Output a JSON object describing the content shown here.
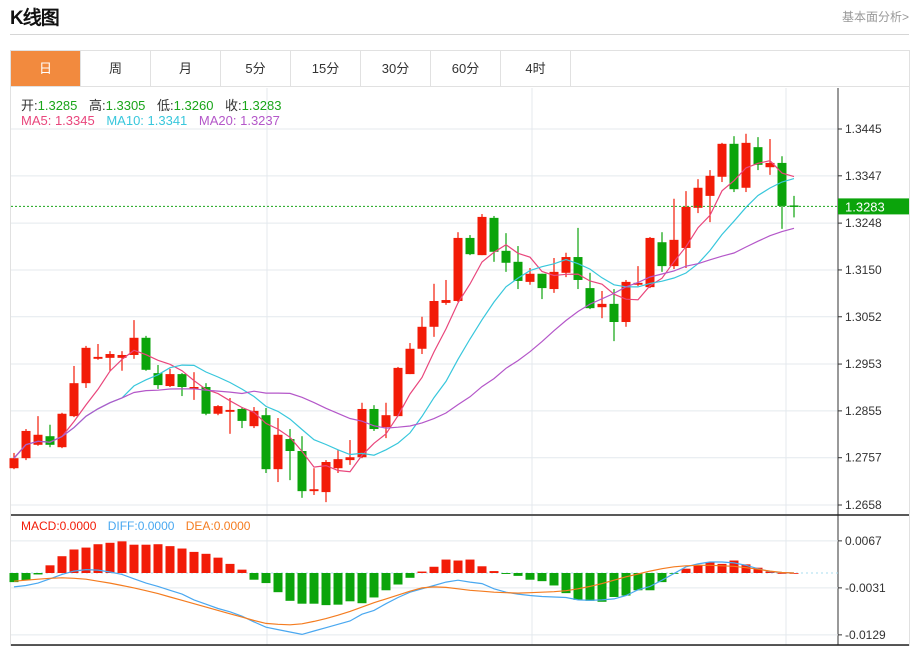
{
  "header": {
    "title": "K线图",
    "link": "基本面分析>"
  },
  "tabs": [
    {
      "label": "日",
      "active": true
    },
    {
      "label": "周"
    },
    {
      "label": "月"
    },
    {
      "label": "5分"
    },
    {
      "label": "15分"
    },
    {
      "label": "30分"
    },
    {
      "label": "60分"
    },
    {
      "label": "4时"
    }
  ],
  "ohlc_info": {
    "open_label": "开:",
    "open": "1.3285",
    "high_label": "高:",
    "high": "1.3305",
    "low_label": "低:",
    "low": "1.3260",
    "close_label": "收:",
    "close": "1.3283"
  },
  "ma_info": {
    "ma5": "MA5: 1.3345",
    "ma10": "MA10: 1.3341",
    "ma20": "MA20: 1.3237"
  },
  "macd_info": {
    "macd": "MACD:0.0000",
    "diff": "DIFF:0.0000",
    "dea": "DEA:0.0000"
  },
  "colors": {
    "up": "#f21b07",
    "down": "#0ba40b",
    "ma5": "#e9467c",
    "ma10": "#38c7dc",
    "ma20": "#b457c9",
    "dea": "#f47c20",
    "diff": "#4aa8f0",
    "accent": "#f28a3e"
  },
  "chart_data": {
    "type": "candlestick",
    "price_axis": {
      "ticks": [
        "1.3445",
        "1.3347",
        "1.3248",
        "1.3150",
        "1.3052",
        "1.2953",
        "1.2855",
        "1.2757",
        "1.2658"
      ],
      "range": [
        1.2658,
        1.3445
      ]
    },
    "last_price": "1.3283",
    "candles": [
      [
        1.2735,
        1.2767,
        1.2733,
        1.2756
      ],
      [
        1.2756,
        1.2817,
        1.2752,
        1.2813
      ],
      [
        1.2784,
        1.2844,
        1.2782,
        1.2805
      ],
      [
        1.2802,
        1.2826,
        1.2779,
        1.2784
      ],
      [
        1.2779,
        1.2851,
        1.2777,
        1.2849
      ],
      [
        1.2844,
        1.2949,
        1.2842,
        1.2913
      ],
      [
        1.2913,
        1.2991,
        1.2903,
        1.2987
      ],
      [
        1.2964,
        1.2995,
        1.2962,
        1.2968
      ],
      [
        1.2966,
        1.298,
        1.2939,
        1.2974
      ],
      [
        1.2966,
        1.298,
        1.2939,
        1.2972
      ],
      [
        1.2972,
        1.3045,
        1.2964,
        1.3008
      ],
      [
        1.3008,
        1.3012,
        1.2939,
        1.2941
      ],
      [
        1.2934,
        1.2951,
        1.2901,
        1.2909
      ],
      [
        1.2907,
        1.2943,
        1.2905,
        1.2932
      ],
      [
        1.2932,
        1.2934,
        1.2886,
        1.2905
      ],
      [
        1.2901,
        1.2936,
        1.2878,
        1.2905
      ],
      [
        1.2905,
        1.2913,
        1.2846,
        1.2849
      ],
      [
        1.2849,
        1.2867,
        1.2846,
        1.2865
      ],
      [
        1.2853,
        1.2882,
        1.2807,
        1.2857
      ],
      [
        1.2859,
        1.2863,
        1.2819,
        1.2834
      ],
      [
        1.2823,
        1.2863,
        1.2819,
        1.2855
      ],
      [
        1.2846,
        1.2861,
        1.2725,
        1.2733
      ],
      [
        1.2733,
        1.284,
        1.2706,
        1.2805
      ],
      [
        1.2796,
        1.2817,
        1.271,
        1.2771
      ],
      [
        1.2771,
        1.2802,
        1.2673,
        1.2687
      ],
      [
        1.2687,
        1.2735,
        1.2679,
        1.2691
      ],
      [
        1.2685,
        1.2752,
        1.2664,
        1.2748
      ],
      [
        1.2735,
        1.2773,
        1.2725,
        1.2754
      ],
      [
        1.2752,
        1.2794,
        1.2742,
        1.2758
      ],
      [
        1.2758,
        1.2872,
        1.2756,
        1.2859
      ],
      [
        1.2859,
        1.2867,
        1.2813,
        1.2817
      ],
      [
        1.2821,
        1.2872,
        1.2798,
        1.2846
      ],
      [
        1.2844,
        1.2947,
        1.2844,
        1.2945
      ],
      [
        1.2932,
        1.2997,
        1.2932,
        1.2985
      ],
      [
        1.2985,
        1.3052,
        1.2974,
        1.3031
      ],
      [
        1.3031,
        1.3121,
        1.301,
        1.3085
      ],
      [
        1.3081,
        1.3129,
        1.3077,
        1.3087
      ],
      [
        1.3085,
        1.3229,
        1.3083,
        1.3217
      ],
      [
        1.3217,
        1.3223,
        1.3181,
        1.3183
      ],
      [
        1.3181,
        1.3267,
        1.3181,
        1.3261
      ],
      [
        1.3259,
        1.3263,
        1.3167,
        1.3188
      ],
      [
        1.319,
        1.3227,
        1.3146,
        1.3165
      ],
      [
        1.3167,
        1.32,
        1.311,
        1.3127
      ],
      [
        1.3125,
        1.3154,
        1.3119,
        1.3142
      ],
      [
        1.3142,
        1.3142,
        1.3089,
        1.3112
      ],
      [
        1.311,
        1.3175,
        1.3102,
        1.3146
      ],
      [
        1.3144,
        1.3186,
        1.3135,
        1.3177
      ],
      [
        1.3177,
        1.3238,
        1.311,
        1.3129
      ],
      [
        1.3112,
        1.3144,
        1.3068,
        1.307
      ],
      [
        1.3072,
        1.3106,
        1.3049,
        1.3079
      ],
      [
        1.3079,
        1.311,
        1.3001,
        1.3041
      ],
      [
        1.3041,
        1.3129,
        1.3031,
        1.3125
      ],
      [
        1.3119,
        1.3158,
        1.3116,
        1.3123
      ],
      [
        1.3114,
        1.3219,
        1.3112,
        1.3217
      ],
      [
        1.3208,
        1.3229,
        1.3146,
        1.3158
      ],
      [
        1.3158,
        1.3299,
        1.3152,
        1.3213
      ],
      [
        1.3196,
        1.3315,
        1.3154,
        1.3282
      ],
      [
        1.328,
        1.334,
        1.3269,
        1.3322
      ],
      [
        1.3305,
        1.3359,
        1.325,
        1.3347
      ],
      [
        1.3345,
        1.3416,
        1.3334,
        1.3414
      ],
      [
        1.3414,
        1.343,
        1.3313,
        1.3319
      ],
      [
        1.3322,
        1.3435,
        1.3313,
        1.3416
      ],
      [
        1.3407,
        1.3428,
        1.3359,
        1.337
      ],
      [
        1.3365,
        1.3424,
        1.3349,
        1.3374
      ],
      [
        1.3374,
        1.3388,
        1.3236,
        1.3284
      ],
      [
        1.3285,
        1.3305,
        1.326,
        1.3283
      ]
    ],
    "macd_axis": {
      "ticks": [
        "0.0067",
        "-0.0031",
        "-0.0129"
      ]
    },
    "macd_hist": [
      -0.0019,
      -0.0015,
      -0.0003,
      0.0016,
      0.0035,
      0.0049,
      0.0053,
      0.006,
      0.0063,
      0.0066,
      0.0059,
      0.0059,
      0.006,
      0.0056,
      0.0051,
      0.0044,
      0.004,
      0.0032,
      0.0019,
      0.0007,
      -0.0014,
      -0.0021,
      -0.004,
      -0.0058,
      -0.0064,
      -0.0064,
      -0.0067,
      -0.0066,
      -0.0059,
      -0.0063,
      -0.0051,
      -0.0036,
      -0.0024,
      -0.001,
      0.0003,
      0.0013,
      0.0028,
      0.0026,
      0.0028,
      0.0014,
      0.0004,
      -0.0002,
      -0.0006,
      -0.0014,
      -0.0017,
      -0.0026,
      -0.0042,
      -0.0056,
      -0.0058,
      -0.006,
      -0.005,
      -0.0047,
      -0.0036,
      -0.0036,
      -0.0019,
      -0.0001,
      0.0009,
      0.0017,
      0.0023,
      0.0019,
      0.0026,
      0.0018,
      0.0011,
      0.0003,
      0,
      0
    ],
    "diff": [
      -0.0029,
      -0.0026,
      -0.0021,
      -0.0012,
      -0.0003,
      0.0004,
      0.0007,
      0.0006,
      0.0002,
      -0.0003,
      -0.0012,
      -0.0021,
      -0.0028,
      -0.0036,
      -0.0044,
      -0.0056,
      -0.0065,
      -0.0074,
      -0.0081,
      -0.009,
      -0.0102,
      -0.0113,
      -0.0118,
      -0.0123,
      -0.0128,
      -0.0121,
      -0.0114,
      -0.0107,
      -0.01,
      -0.0086,
      -0.0078,
      -0.0064,
      -0.0051,
      -0.004,
      -0.0033,
      -0.0026,
      -0.0019,
      -0.0015,
      -0.0019,
      -0.0022,
      -0.0033,
      -0.004,
      -0.0044,
      -0.0047,
      -0.0049,
      -0.005,
      -0.0051,
      -0.0056,
      -0.0057,
      -0.0056,
      -0.0054,
      -0.0047,
      -0.0035,
      -0.0028,
      -0.0015,
      -0.0001,
      0.0013,
      0.0019,
      0.0023,
      0.0023,
      0.0021,
      0.0016,
      0.0009,
      0.0003,
      0.0001,
      0
    ],
    "dea": [
      -0.0017,
      -0.0015,
      -0.0013,
      -0.0011,
      -0.001,
      -0.0011,
      -0.0013,
      -0.0017,
      -0.0021,
      -0.0026,
      -0.0031,
      -0.0037,
      -0.0043,
      -0.005,
      -0.0057,
      -0.0064,
      -0.0071,
      -0.0078,
      -0.0085,
      -0.0092,
      -0.0099,
      -0.0105,
      -0.0107,
      -0.0108,
      -0.0106,
      -0.0101,
      -0.0095,
      -0.0088,
      -0.008,
      -0.0071,
      -0.0062,
      -0.0054,
      -0.0046,
      -0.0038,
      -0.0031,
      -0.0029,
      -0.003,
      -0.0033,
      -0.0036,
      -0.0038,
      -0.004,
      -0.0041,
      -0.0042,
      -0.0041,
      -0.004,
      -0.0039,
      -0.0037,
      -0.0033,
      -0.0028,
      -0.0022,
      -0.0015,
      -0.0008,
      -0.0002,
      0.0004,
      0.0009,
      0.0013,
      0.0015,
      0.0016,
      0.0016,
      0.0015,
      0.0014,
      0.0011,
      0.0008,
      0.0004,
      0.0001,
      0
    ]
  }
}
